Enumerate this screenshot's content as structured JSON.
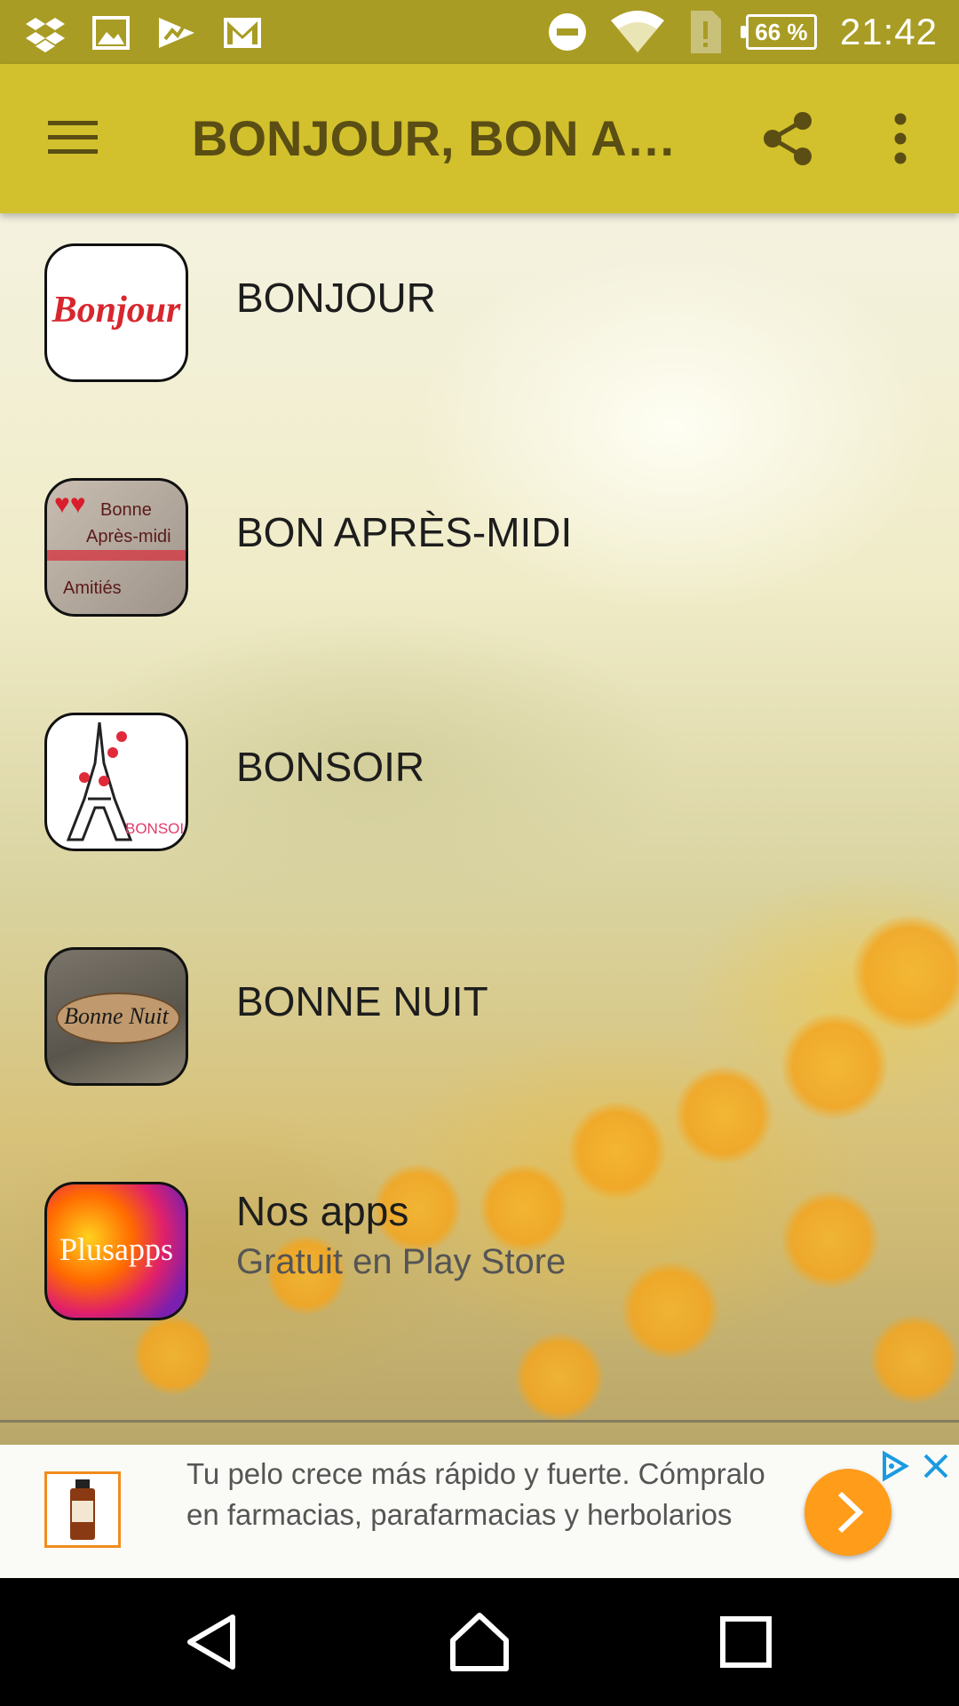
{
  "status_bar": {
    "left_icons": [
      "dropbox-icon",
      "gallery-icon",
      "analytics-icon",
      "gmail-icon"
    ],
    "right_icons": [
      "do-not-disturb-icon",
      "wifi-icon",
      "no-sim-icon",
      "battery-icon"
    ],
    "battery_level": "66 %",
    "time": "21:42"
  },
  "app_bar": {
    "title": "BONJOUR, BON APRÈS-MIDI, BONSOIR, BONNE NUIT",
    "icons": [
      "menu-icon",
      "share-icon",
      "more-vert-icon"
    ]
  },
  "items": [
    {
      "label": "BONJOUR",
      "thumb_text": "Bonjour"
    },
    {
      "label": "BON APRÈS-MIDI",
      "thumb_text": [
        "Bonne",
        "Après-midi",
        "Amitiés"
      ]
    },
    {
      "label": "BONSOIR",
      "thumb_text": "BONSOIR"
    },
    {
      "label": "BONNE NUIT",
      "thumb_text": "Bonne Nuit"
    },
    {
      "label": "Nos apps",
      "sublabel": "Gratuit en Play Store",
      "thumb_text": "Plusapps"
    }
  ],
  "ad": {
    "text": "Tu pelo crece más rápido y fuerte. Cómpralo en farmacias, parafarmacias y herbolarios",
    "icons": [
      "adchoices-icon",
      "close-icon",
      "arrow-right-icon"
    ],
    "accent_color": "#ff9c1a"
  },
  "nav_bar": {
    "icons": [
      "back-icon",
      "home-icon",
      "recents-icon"
    ]
  },
  "colors": {
    "status_bar": "#a89c24",
    "app_bar": "#d2c12c",
    "title": "#5a4e14"
  }
}
